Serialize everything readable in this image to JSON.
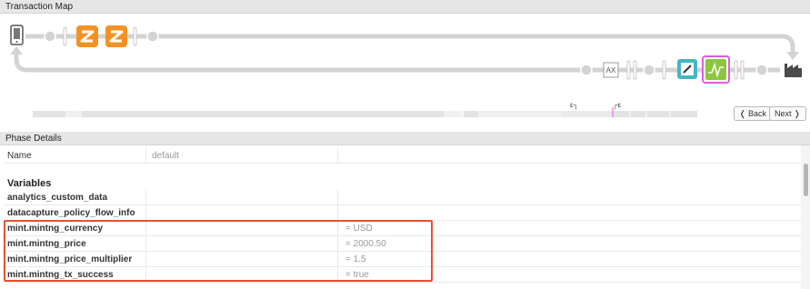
{
  "map_header": {
    "title": "Transaction Map"
  },
  "phase_header": {
    "title": "Phase Details"
  },
  "map": {
    "icons": [
      "mobile-device-icon",
      "shuffle-icon",
      "shuffle-icon",
      "ax-icon",
      "edit-icon",
      "activity-icon",
      "factory-icon"
    ],
    "ax_label": "AX",
    "timeline_markers": [
      "ε┐",
      "┌ε"
    ],
    "colors": {
      "orange": "#f39223",
      "teal": "#45b5c4",
      "green": "#8cc63f",
      "magenta": "#e05ce0",
      "track": "#d3d3d3"
    }
  },
  "nav": {
    "back_label": "❬ Back",
    "next_label": "Next ❭"
  },
  "details": {
    "name_row": {
      "label": "Name",
      "value": "default"
    },
    "variables_title": "Variables",
    "variables": [
      {
        "name": "analytics_custom_data",
        "value": ""
      },
      {
        "name": "datacapture_policy_flow_info",
        "value": ""
      },
      {
        "name": "mint.mintng_currency",
        "value": "= USD"
      },
      {
        "name": "mint.mintng_price",
        "value": "= 2000.50"
      },
      {
        "name": "mint.mintng_price_multiplier",
        "value": "= 1.5"
      },
      {
        "name": "mint.mintng_tx_success",
        "value": "= true"
      }
    ]
  }
}
